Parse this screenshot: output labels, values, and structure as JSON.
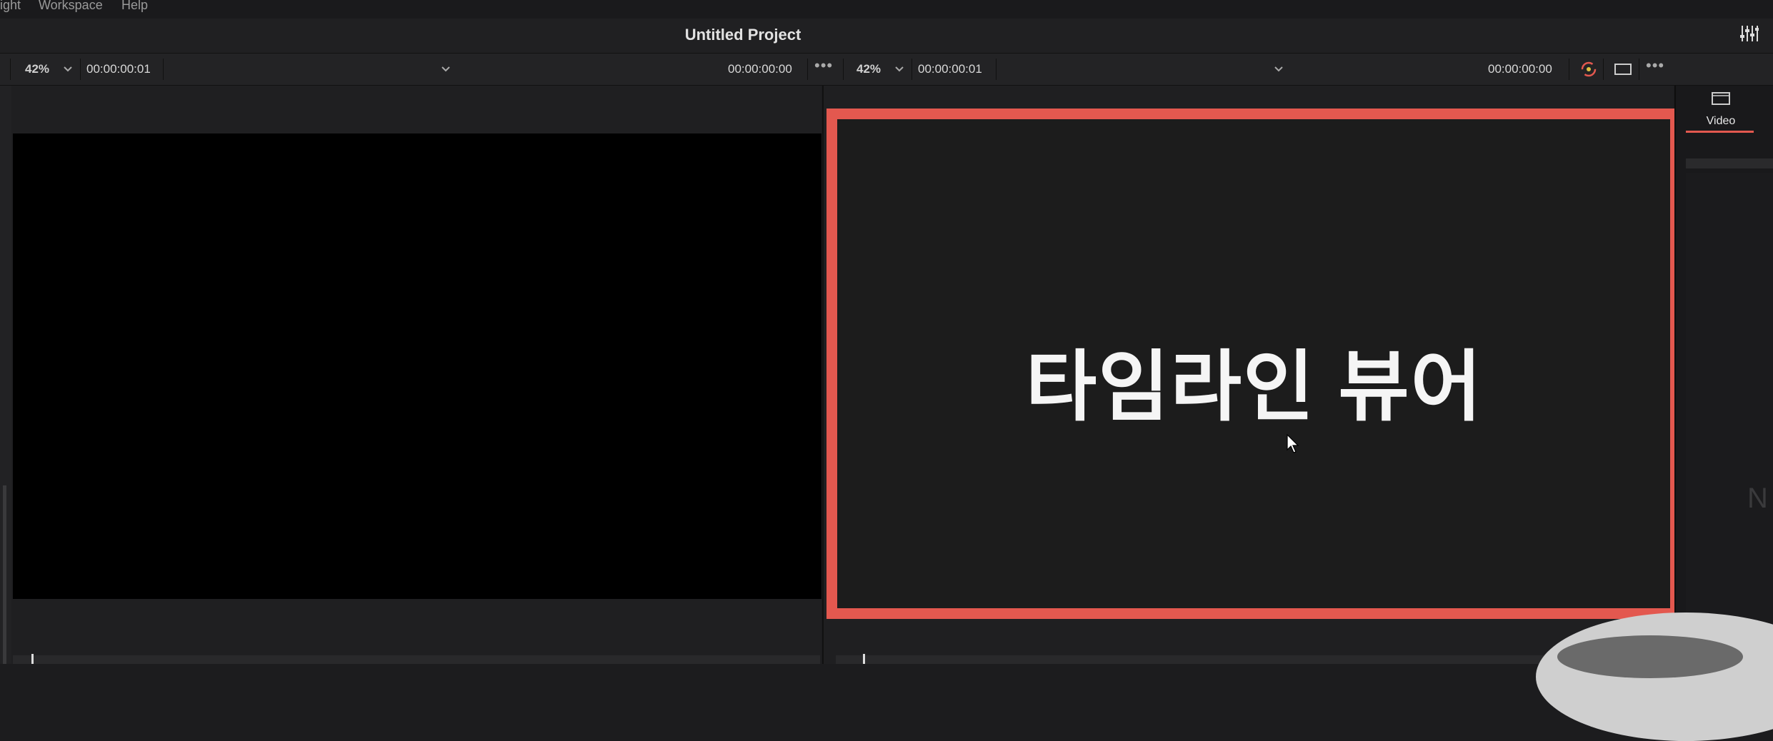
{
  "menu": {
    "items": [
      "ight",
      "Workspace",
      "Help"
    ]
  },
  "project": {
    "title": "Untitled Project"
  },
  "source_viewer": {
    "zoom": "42%",
    "timecode_left": "00:00:00:01",
    "timecode_right": "00:00:00:00"
  },
  "timeline_viewer": {
    "zoom": "42%",
    "timecode_left": "00:00:00:01",
    "timecode_right": "00:00:00:00",
    "overlay_text": "타임라인 뷰어"
  },
  "inspector": {
    "tab_label": "Video",
    "partial_text": "N"
  },
  "colors": {
    "highlight": "#e3584f",
    "background": "#1c1c1e",
    "accent": "#e3584f"
  },
  "icons": {
    "mixer": "sliders-icon",
    "cursor": "mouse-cursor-icon",
    "video": "film-frame-icon"
  }
}
